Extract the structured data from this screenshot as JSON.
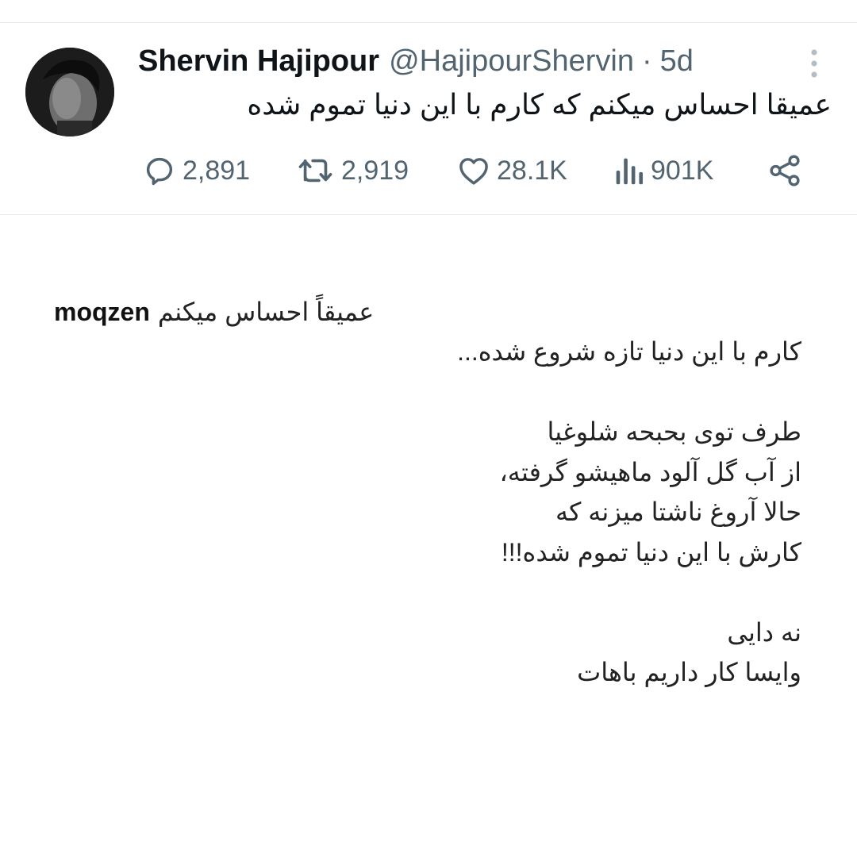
{
  "tweet": {
    "author": {
      "name": "Shervin Hajipour",
      "handle": "@HajipourShervin",
      "separator": "·",
      "time": "5d"
    },
    "text": "عمیقا احساس میکنم که کارم با این دنیا تموم شده",
    "actions": {
      "replies": "2,891",
      "retweets": "2,919",
      "likes": "28.1K",
      "views": "901K"
    },
    "icons": {
      "more": "more-vertical-icon",
      "reply": "reply-icon",
      "retweet": "retweet-icon",
      "like": "heart-icon",
      "views": "views-bars-icon",
      "share": "share-icon"
    }
  },
  "response": {
    "username": "moqzen",
    "lead": "عمیقاً احساس میکنم",
    "lines": [
      "کارم با این دنیا تازه شروع شده...",
      "",
      "طرف توی بحبحه شلوغیا",
      "از آب گل آلود ماهیشو گرفته،",
      "حالا آروغ ناشتا میزنه که",
      "کارش با این دنیا تموم شده!!!",
      "",
      "نه دایی",
      "وایسا کار داریم باهات"
    ]
  },
  "colors": {
    "text": "#0f1419",
    "muted": "#536471",
    "divider": "#e6e9ec",
    "background": "#ffffff"
  }
}
